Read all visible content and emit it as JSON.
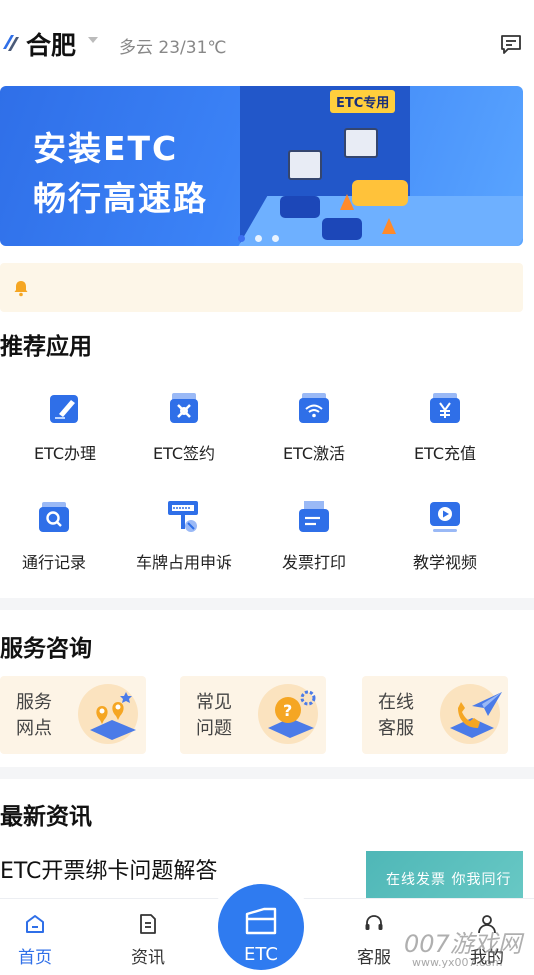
{
  "header": {
    "city": "合肥",
    "weather": "多云 23/31℃"
  },
  "banner": {
    "tag": "ETC专用",
    "title_line1": "安装ETC",
    "title_line2": "畅行高速路",
    "slide_count": 3,
    "active_slide": 0
  },
  "notice": {
    "text": ""
  },
  "recommended": {
    "title": "推荐应用",
    "items": [
      {
        "label": "ETC办理",
        "icon": "edit-card-icon"
      },
      {
        "label": "ETC签约",
        "icon": "contract-icon"
      },
      {
        "label": "ETC激活",
        "icon": "wifi-card-icon"
      },
      {
        "label": "ETC充值",
        "icon": "yen-card-icon"
      },
      {
        "label": "通行记录",
        "icon": "search-record-icon"
      },
      {
        "label": "车牌占用申诉",
        "icon": "plate-appeal-icon"
      },
      {
        "label": "发票打印",
        "icon": "printer-icon"
      },
      {
        "label": "教学视频",
        "icon": "video-play-icon"
      }
    ]
  },
  "service": {
    "title": "服务咨询",
    "items": [
      {
        "label": "服务网点",
        "icon": "location-pins-icon"
      },
      {
        "label": "常见问题",
        "icon": "question-gear-icon"
      },
      {
        "label": "在线客服",
        "icon": "phone-plane-icon"
      }
    ]
  },
  "news": {
    "title": "最新资讯",
    "items": [
      {
        "title": "ETC开票绑卡问题解答",
        "thumb_text": "在线发票 你我同行"
      }
    ]
  },
  "tabbar": {
    "items": [
      {
        "label": "首页",
        "icon": "home-icon",
        "active": true
      },
      {
        "label": "资讯",
        "icon": "news-doc-icon",
        "active": false
      },
      {
        "label": "ETC",
        "icon": "etc-card-icon",
        "active": false
      },
      {
        "label": "客服",
        "icon": "headset-icon",
        "active": false
      },
      {
        "label": "我的",
        "icon": "user-icon",
        "active": false
      }
    ]
  },
  "watermark": {
    "text": "007游戏网",
    "url": "www.yx007.com"
  },
  "colors": {
    "primary": "#2f6fe8",
    "notice_bg": "#fdf6e8",
    "service_bg": "#fdf4e6",
    "bell": "#f5a623"
  }
}
